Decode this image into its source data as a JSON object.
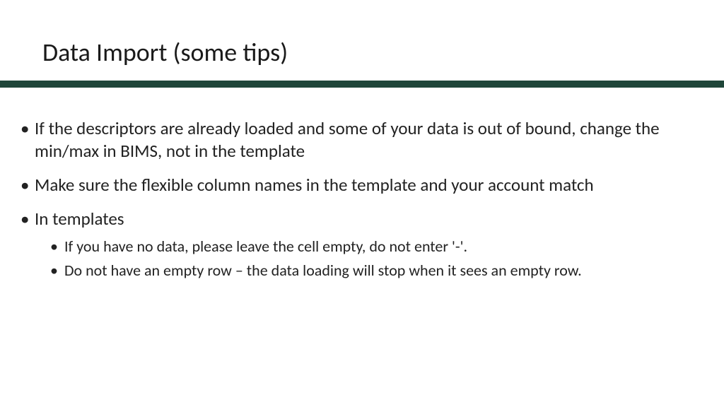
{
  "title": "Data Import (some tips)",
  "bullets": {
    "item0": "If the descriptors are already loaded and some of your data is out of bound, change the min/max in BIMS, not in the template",
    "item1": "Make sure the flexible column names in the template and your account match",
    "item2": "In templates",
    "sub0": "If you have no data, please leave the cell empty, do not enter '-'.",
    "sub1": "Do not have an empty row – the data loading will stop when it sees an empty row."
  }
}
